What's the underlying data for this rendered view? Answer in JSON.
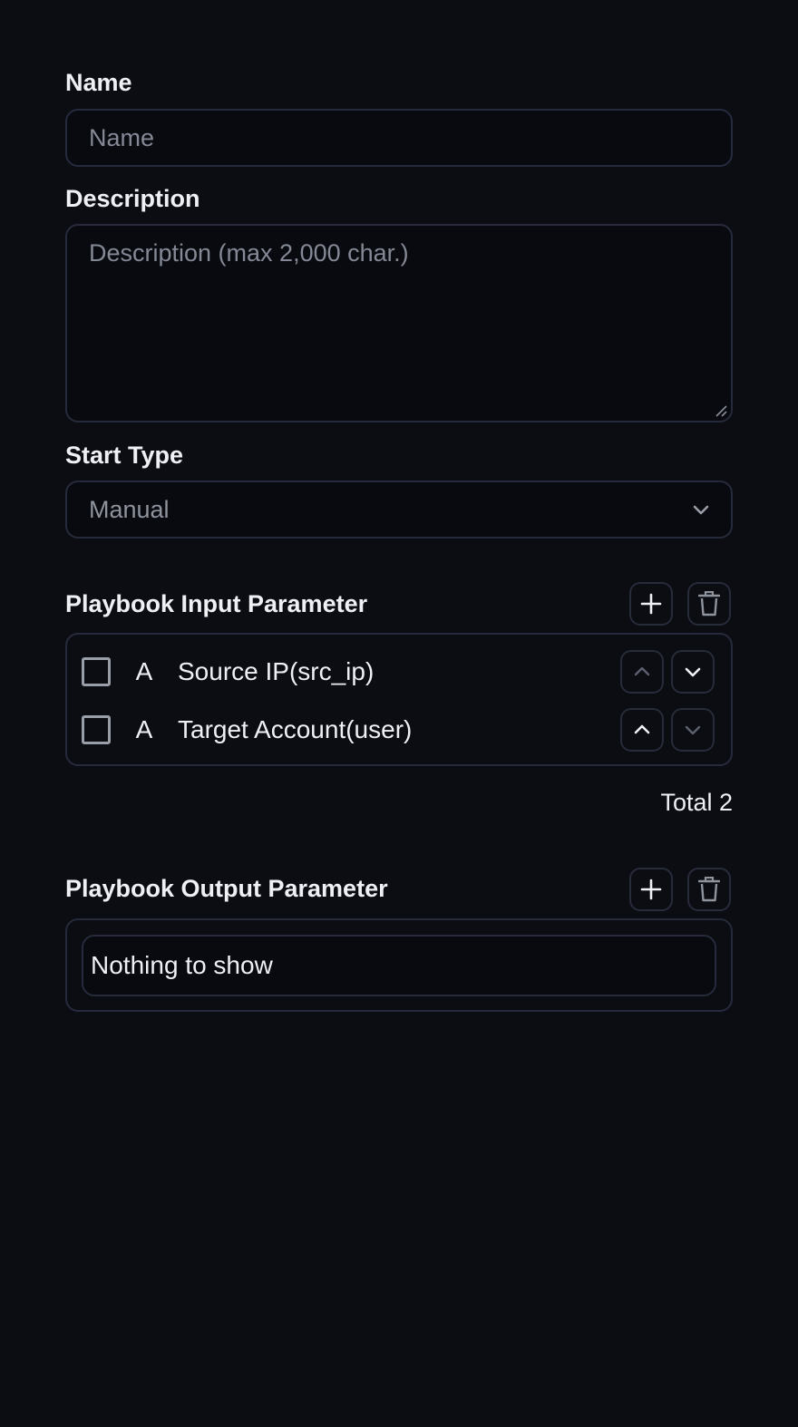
{
  "name": {
    "label": "Name",
    "placeholder": "Name",
    "value": ""
  },
  "description": {
    "label": "Description",
    "placeholder": "Description (max 2,000 char.)",
    "value": ""
  },
  "start_type": {
    "label": "Start Type",
    "selected": "Manual"
  },
  "input_params": {
    "title": "Playbook Input Parameter",
    "add_icon": "plus-icon",
    "delete_icon": "trash-icon",
    "items": [
      {
        "type": "A",
        "label": "Source IP(src_ip)",
        "checked": false
      },
      {
        "type": "A",
        "label": "Target Account(user)",
        "checked": false
      }
    ],
    "total": "Total 2"
  },
  "output_params": {
    "title": "Playbook Output Parameter",
    "add_icon": "plus-icon",
    "delete_icon": "trash-icon",
    "empty_text": "Nothing to show"
  },
  "colors": {
    "background": "#0b0d13",
    "field_bg": "#080a10",
    "border": "#262a3b",
    "text": "#eef0f4",
    "muted": "#858995"
  }
}
